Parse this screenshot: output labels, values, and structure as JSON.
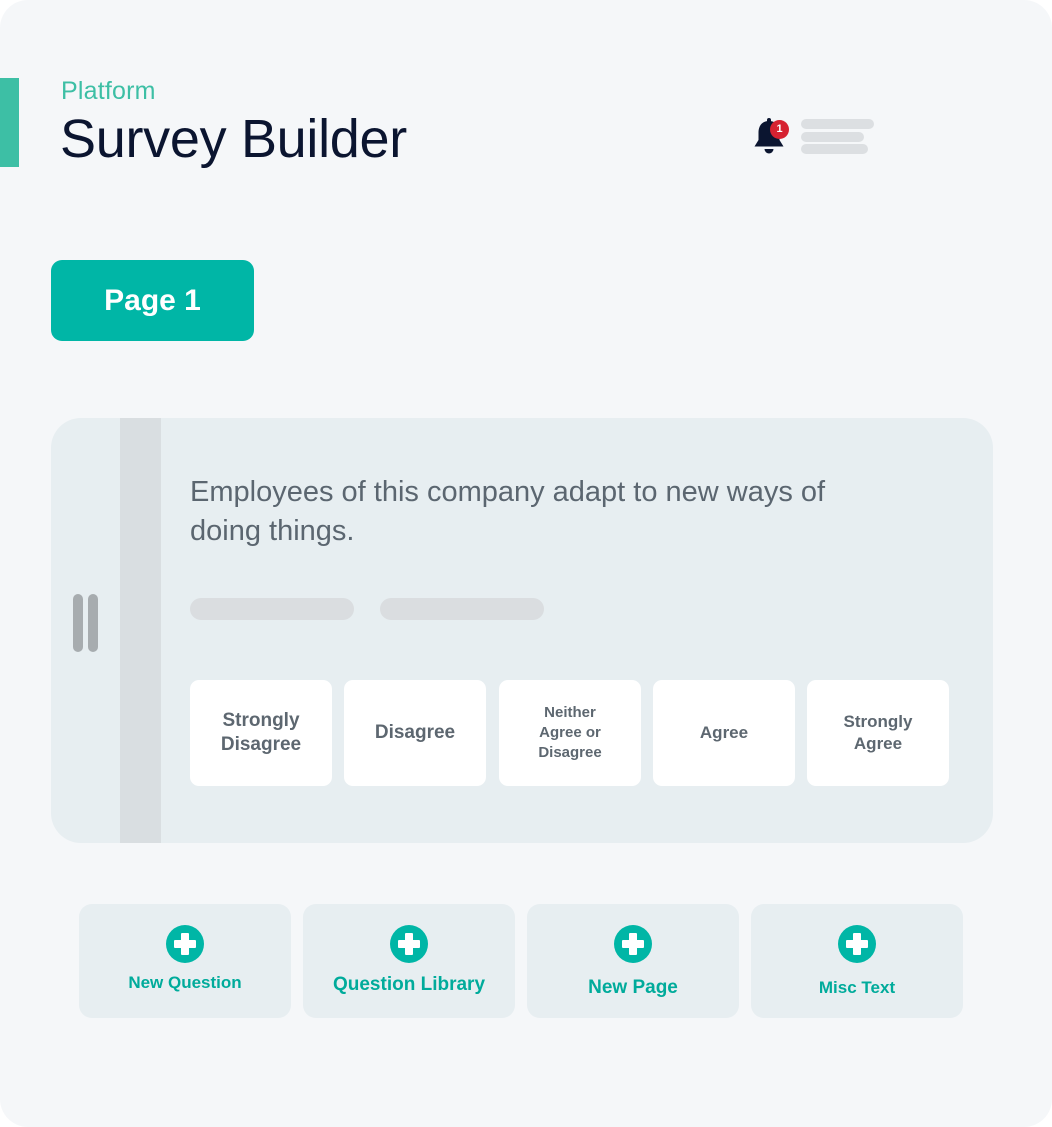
{
  "header": {
    "eyebrow": "Platform",
    "title": "Survey Builder",
    "notification_count": "1"
  },
  "icons": {
    "notification": "bell-icon",
    "menu": "hamburger-menu-icon",
    "drag": "drag-handle-icon",
    "add": "plus-circle-icon"
  },
  "page_tab": {
    "label": "Page 1"
  },
  "question": {
    "text": "Employees of this company adapt to new ways of doing things.",
    "options": [
      {
        "label": "Strongly Disagree"
      },
      {
        "label": "Disagree"
      },
      {
        "label": "Neither Agree or Disagree"
      },
      {
        "label": "Agree"
      },
      {
        "label": "Strongly Agree"
      }
    ]
  },
  "actions": [
    {
      "label": "New Question"
    },
    {
      "label": "Question Library"
    },
    {
      "label": "New Page"
    },
    {
      "label": "Misc Text"
    }
  ],
  "colors": {
    "accent": "#00b6a6",
    "accent_text": "#00ab9b",
    "eyebrow": "#3dbfa5",
    "title": "#0b1530",
    "badge": "#d62231",
    "card_bg": "#e7eef1",
    "background": "#f5f7f9"
  }
}
